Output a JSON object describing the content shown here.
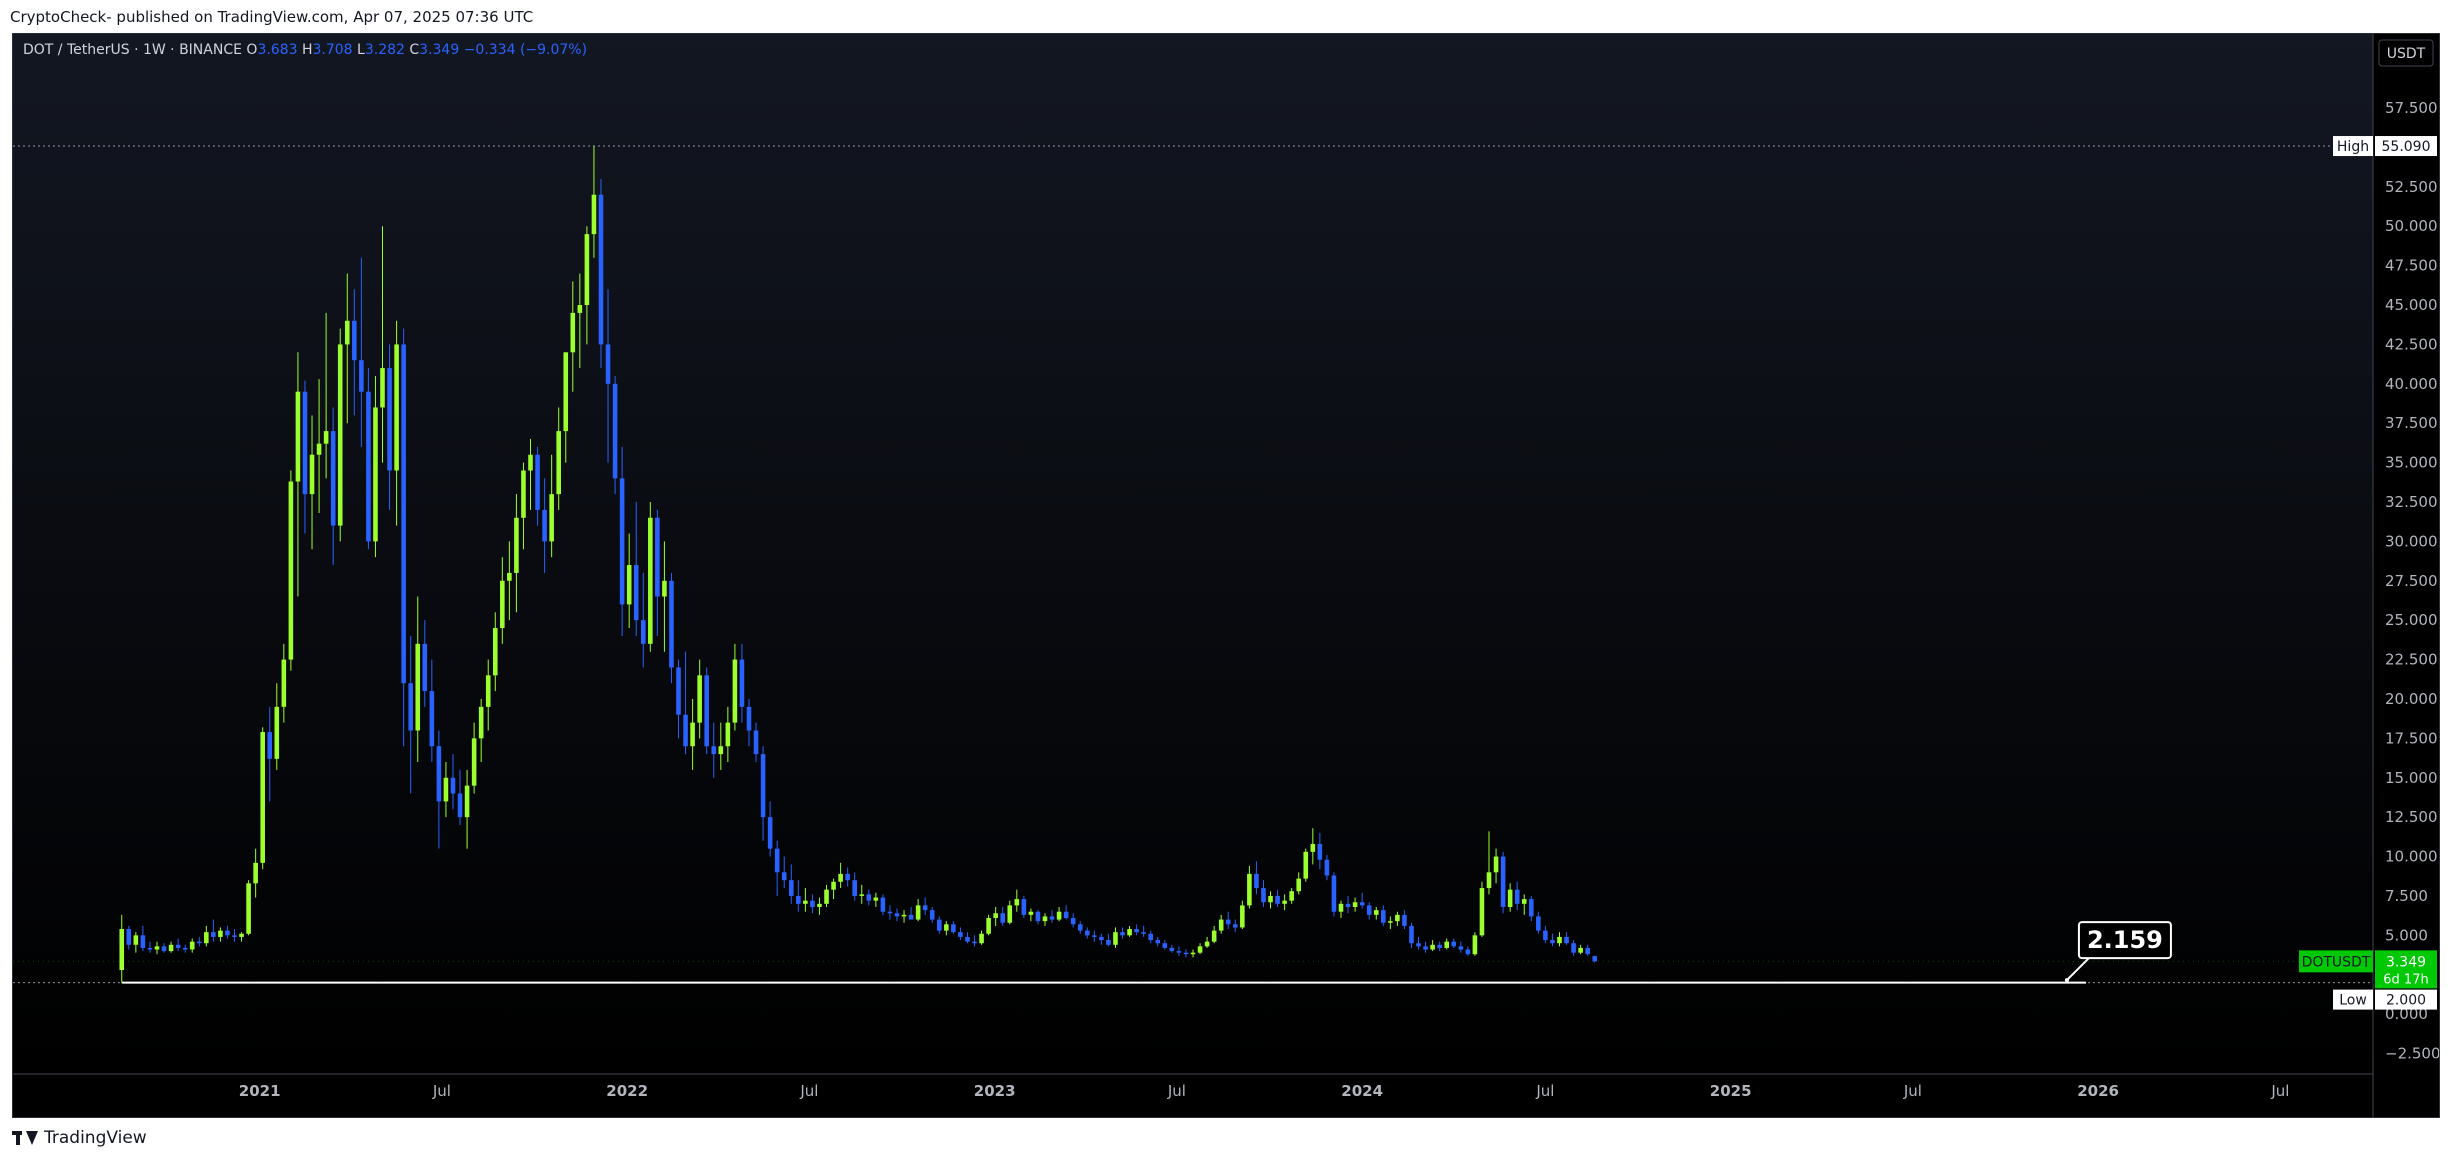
{
  "header": {
    "publisher": "CryptoCheck- published on TradingView.com, Apr 07, 2025 07:36 UTC"
  },
  "footer": {
    "brand": "TradingView"
  },
  "colors": {
    "up": "#9cff2e",
    "down": "#2962ff",
    "background": "#000000",
    "text": "#d1d4dc",
    "axis": "#b2b5be",
    "price_badge": "#00c805",
    "last_price_line": "#7a7a7a"
  },
  "chart_data": {
    "type": "candlestick",
    "symbol_line": {
      "symbol": "DOT / TetherUS · 1W · BINANCE",
      "o_label": "O",
      "o_value": "3.683",
      "h_label": "H",
      "h_value": "3.708",
      "l_label": "L",
      "l_value": "3.282",
      "c_label": "C",
      "c_value": "3.349",
      "change": "−0.334 (−9.07%)"
    },
    "currency": "USDT",
    "ylim": [
      -3.8,
      62.2
    ],
    "y_ticks": [
      57.5,
      52.5,
      50,
      47.5,
      45,
      42.5,
      40,
      37.5,
      35,
      32.5,
      30,
      27.5,
      25,
      22.5,
      20,
      17.5,
      15,
      12.5,
      10,
      7.5,
      5,
      0,
      -2.5
    ],
    "y_tick_labels": [
      "57.500",
      "52.500",
      "50.000",
      "47.500",
      "45.000",
      "42.500",
      "40.000",
      "37.500",
      "35.000",
      "32.500",
      "30.000",
      "27.500",
      "25.000",
      "22.500",
      "20.000",
      "17.500",
      "15.000",
      "12.500",
      "10.000",
      "7.500",
      "5.000",
      "0.000",
      "−2.500"
    ],
    "xlim": [
      "2020-05-01",
      "2026-10-01"
    ],
    "x_ticks": [
      {
        "date": "2021-01-01",
        "label": "2021",
        "bold": true
      },
      {
        "date": "2021-07-01",
        "label": "Jul",
        "bold": false
      },
      {
        "date": "2022-01-01",
        "label": "2022",
        "bold": true
      },
      {
        "date": "2022-07-01",
        "label": "Jul",
        "bold": false
      },
      {
        "date": "2023-01-01",
        "label": "2023",
        "bold": true
      },
      {
        "date": "2023-07-01",
        "label": "Jul",
        "bold": false
      },
      {
        "date": "2024-01-01",
        "label": "2024",
        "bold": true
      },
      {
        "date": "2024-07-01",
        "label": "Jul",
        "bold": false
      },
      {
        "date": "2025-01-01",
        "label": "2025",
        "bold": true
      },
      {
        "date": "2025-07-01",
        "label": "Jul",
        "bold": false
      },
      {
        "date": "2026-01-01",
        "label": "2026",
        "bold": true
      },
      {
        "date": "2026-07-01",
        "label": "Jul",
        "bold": false
      }
    ],
    "first_candle": "2020-08-17",
    "interval": "1W",
    "candles": [
      [
        2.8,
        6.3,
        2.0,
        5.4
      ],
      [
        5.4,
        5.6,
        4.1,
        4.4
      ],
      [
        4.4,
        5.2,
        3.9,
        5.0
      ],
      [
        5.0,
        5.6,
        4.0,
        4.2
      ],
      [
        4.2,
        4.6,
        3.9,
        4.1
      ],
      [
        4.1,
        4.6,
        3.8,
        4.3
      ],
      [
        4.3,
        4.5,
        3.9,
        4.0
      ],
      [
        4.0,
        4.6,
        3.9,
        4.4
      ],
      [
        4.4,
        4.8,
        4.0,
        4.2
      ],
      [
        4.2,
        4.4,
        3.9,
        4.1
      ],
      [
        4.1,
        4.8,
        3.9,
        4.6
      ],
      [
        4.6,
        4.9,
        4.3,
        4.5
      ],
      [
        4.5,
        5.6,
        4.3,
        5.2
      ],
      [
        5.2,
        6.0,
        4.6,
        4.9
      ],
      [
        4.9,
        5.5,
        4.6,
        5.3
      ],
      [
        5.3,
        5.6,
        4.8,
        5.0
      ],
      [
        5.0,
        5.4,
        4.6,
        4.9
      ],
      [
        4.9,
        5.2,
        4.6,
        5.1
      ],
      [
        5.1,
        8.5,
        5.0,
        8.3
      ],
      [
        8.3,
        10.5,
        7.4,
        9.6
      ],
      [
        9.6,
        18.2,
        9.2,
        17.9
      ],
      [
        17.9,
        19.5,
        13.5,
        16.2
      ],
      [
        16.2,
        21.0,
        15.5,
        19.5
      ],
      [
        19.5,
        23.5,
        18.5,
        22.5
      ],
      [
        22.5,
        34.5,
        21.8,
        33.8
      ],
      [
        33.8,
        42.0,
        26.5,
        39.5
      ],
      [
        39.5,
        40.2,
        30.5,
        33.0
      ],
      [
        33.0,
        38.0,
        29.5,
        35.5
      ],
      [
        35.5,
        40.3,
        31.8,
        36.2
      ],
      [
        36.2,
        44.5,
        34.0,
        37.0
      ],
      [
        37.0,
        38.5,
        28.5,
        31.0
      ],
      [
        31.0,
        43.5,
        30.0,
        42.5
      ],
      [
        42.5,
        47.0,
        37.5,
        44.0
      ],
      [
        44.0,
        46.0,
        38.0,
        41.5
      ],
      [
        41.5,
        48.0,
        36.0,
        39.5
      ],
      [
        39.5,
        41.0,
        29.5,
        30.0
      ],
      [
        30.0,
        40.5,
        29.0,
        38.5
      ],
      [
        38.5,
        50.0,
        35.0,
        41.0
      ],
      [
        41.0,
        42.5,
        32.0,
        34.5
      ],
      [
        34.5,
        44.0,
        31.0,
        42.5
      ],
      [
        42.5,
        43.5,
        17.0,
        21.0
      ],
      [
        21.0,
        24.0,
        14.0,
        18.0
      ],
      [
        18.0,
        26.5,
        16.0,
        23.5
      ],
      [
        23.5,
        25.0,
        19.5,
        20.5
      ],
      [
        20.5,
        22.5,
        16.0,
        17.0
      ],
      [
        17.0,
        18.0,
        10.5,
        13.5
      ],
      [
        13.5,
        16.0,
        12.5,
        15.0
      ],
      [
        15.0,
        16.5,
        13.0,
        14.0
      ],
      [
        14.0,
        15.5,
        12.0,
        12.5
      ],
      [
        12.5,
        15.5,
        10.5,
        14.5
      ],
      [
        14.5,
        18.5,
        14.0,
        17.5
      ],
      [
        17.5,
        20.0,
        16.0,
        19.5
      ],
      [
        19.5,
        22.5,
        18.0,
        21.5
      ],
      [
        21.5,
        25.5,
        20.5,
        24.5
      ],
      [
        24.5,
        29.0,
        23.5,
        27.5
      ],
      [
        27.5,
        30.0,
        25.0,
        28.0
      ],
      [
        28.0,
        33.0,
        25.5,
        31.5
      ],
      [
        31.5,
        35.0,
        29.5,
        34.5
      ],
      [
        34.5,
        36.5,
        32.0,
        35.5
      ],
      [
        35.5,
        36.0,
        31.0,
        32.0
      ],
      [
        32.0,
        34.0,
        28.0,
        30.0
      ],
      [
        30.0,
        35.5,
        29.0,
        33.0
      ],
      [
        33.0,
        38.5,
        32.0,
        37.0
      ],
      [
        37.0,
        42.0,
        35.0,
        42.0
      ],
      [
        42.0,
        46.5,
        39.5,
        44.5
      ],
      [
        44.5,
        47.0,
        41.0,
        45.0
      ],
      [
        45.0,
        50.0,
        42.5,
        49.5
      ],
      [
        49.5,
        55.1,
        48.0,
        52.0
      ],
      [
        52.0,
        53.0,
        41.0,
        42.5
      ],
      [
        42.5,
        46.0,
        35.0,
        40.0
      ],
      [
        40.0,
        40.5,
        33.0,
        34.0
      ],
      [
        34.0,
        36.0,
        24.0,
        26.0
      ],
      [
        26.0,
        30.5,
        24.5,
        28.5
      ],
      [
        28.5,
        32.5,
        24.0,
        25.0
      ],
      [
        25.0,
        28.0,
        22.0,
        23.5
      ],
      [
        23.5,
        32.5,
        23.0,
        31.5
      ],
      [
        31.5,
        32.0,
        24.0,
        26.5
      ],
      [
        26.5,
        30.0,
        23.0,
        27.5
      ],
      [
        27.5,
        28.0,
        21.0,
        22.0
      ],
      [
        22.0,
        22.5,
        17.5,
        19.0
      ],
      [
        19.0,
        23.0,
        16.5,
        17.0
      ],
      [
        17.0,
        20.0,
        15.5,
        18.5
      ],
      [
        18.5,
        22.5,
        17.5,
        21.5
      ],
      [
        21.5,
        22.0,
        16.5,
        17.0
      ],
      [
        17.0,
        18.5,
        15.0,
        16.5
      ],
      [
        16.5,
        18.5,
        15.5,
        17.0
      ],
      [
        17.0,
        19.5,
        16.0,
        18.5
      ],
      [
        18.5,
        23.5,
        18.0,
        22.5
      ],
      [
        22.5,
        23.5,
        18.5,
        19.5
      ],
      [
        19.5,
        20.0,
        17.0,
        18.0
      ],
      [
        18.0,
        18.5,
        16.0,
        16.5
      ],
      [
        16.5,
        17.0,
        11.0,
        12.5
      ],
      [
        12.5,
        13.5,
        10.0,
        10.5
      ],
      [
        10.5,
        11.0,
        7.5,
        9.0
      ],
      [
        9.0,
        10.0,
        8.0,
        8.5
      ],
      [
        8.5,
        9.5,
        7.0,
        7.5
      ],
      [
        7.5,
        8.5,
        6.5,
        7.0
      ],
      [
        7.0,
        8.0,
        6.5,
        7.2
      ],
      [
        7.2,
        7.6,
        6.4,
        6.8
      ],
      [
        6.8,
        7.4,
        6.3,
        7.0
      ],
      [
        7.0,
        8.2,
        6.8,
        7.9
      ],
      [
        7.9,
        8.6,
        7.3,
        8.4
      ],
      [
        8.4,
        9.6,
        8.0,
        8.9
      ],
      [
        8.9,
        9.3,
        8.1,
        8.5
      ],
      [
        8.5,
        9.0,
        7.2,
        7.5
      ],
      [
        7.5,
        8.2,
        7.0,
        7.6
      ],
      [
        7.6,
        7.9,
        6.9,
        7.2
      ],
      [
        7.2,
        7.7,
        6.8,
        7.4
      ],
      [
        7.4,
        7.6,
        6.3,
        6.5
      ],
      [
        6.5,
        6.9,
        6.0,
        6.4
      ],
      [
        6.4,
        6.7,
        5.9,
        6.2
      ],
      [
        6.2,
        6.6,
        5.8,
        6.3
      ],
      [
        6.3,
        6.8,
        6.0,
        6.0
      ],
      [
        6.0,
        7.3,
        5.9,
        6.9
      ],
      [
        6.9,
        7.4,
        6.3,
        6.6
      ],
      [
        6.6,
        6.8,
        5.8,
        6.0
      ],
      [
        6.0,
        6.2,
        5.1,
        5.3
      ],
      [
        5.3,
        5.9,
        5.0,
        5.7
      ],
      [
        5.7,
        5.9,
        5.1,
        5.2
      ],
      [
        5.2,
        5.5,
        4.7,
        4.9
      ],
      [
        4.9,
        5.2,
        4.5,
        4.6
      ],
      [
        4.6,
        5.0,
        4.3,
        4.5
      ],
      [
        4.5,
        5.3,
        4.4,
        5.1
      ],
      [
        5.1,
        6.3,
        5.0,
        6.1
      ],
      [
        6.1,
        6.8,
        5.6,
        6.4
      ],
      [
        6.4,
        6.8,
        5.6,
        5.8
      ],
      [
        5.8,
        7.2,
        5.7,
        6.9
      ],
      [
        6.9,
        7.9,
        6.5,
        7.3
      ],
      [
        7.3,
        7.5,
        6.1,
        6.3
      ],
      [
        6.3,
        6.7,
        5.9,
        6.5
      ],
      [
        6.5,
        6.6,
        5.7,
        5.9
      ],
      [
        5.9,
        6.4,
        5.6,
        6.2
      ],
      [
        6.2,
        6.6,
        5.8,
        6.0
      ],
      [
        6.0,
        6.8,
        5.9,
        6.5
      ],
      [
        6.5,
        6.9,
        6.0,
        6.1
      ],
      [
        6.1,
        6.4,
        5.5,
        5.7
      ],
      [
        5.7,
        5.9,
        5.1,
        5.3
      ],
      [
        5.3,
        5.5,
        4.8,
        5.0
      ],
      [
        5.0,
        5.3,
        4.6,
        4.9
      ],
      [
        4.9,
        5.1,
        4.4,
        4.7
      ],
      [
        4.7,
        5.1,
        4.3,
        4.4
      ],
      [
        4.4,
        5.5,
        4.2,
        5.2
      ],
      [
        5.2,
        5.5,
        4.8,
        5.0
      ],
      [
        5.0,
        5.6,
        4.9,
        5.4
      ],
      [
        5.4,
        5.7,
        5.0,
        5.2
      ],
      [
        5.2,
        5.6,
        4.9,
        5.1
      ],
      [
        5.1,
        5.3,
        4.5,
        4.7
      ],
      [
        4.7,
        4.9,
        4.3,
        4.5
      ],
      [
        4.5,
        4.7,
        4.1,
        4.2
      ],
      [
        4.2,
        4.4,
        3.9,
        4.0
      ],
      [
        4.0,
        4.3,
        3.7,
        3.9
      ],
      [
        3.9,
        4.1,
        3.6,
        3.8
      ],
      [
        3.8,
        4.1,
        3.6,
        3.9
      ],
      [
        3.9,
        4.5,
        3.8,
        4.3
      ],
      [
        4.3,
        4.9,
        4.2,
        4.6
      ],
      [
        4.6,
        5.6,
        4.5,
        5.3
      ],
      [
        5.3,
        6.3,
        5.1,
        6.0
      ],
      [
        6.0,
        6.5,
        5.4,
        5.7
      ],
      [
        5.7,
        6.0,
        5.2,
        5.5
      ],
      [
        5.5,
        7.2,
        5.4,
        6.9
      ],
      [
        6.9,
        9.4,
        6.7,
        8.9
      ],
      [
        8.9,
        9.7,
        7.6,
        8.0
      ],
      [
        8.0,
        8.5,
        6.8,
        7.1
      ],
      [
        7.1,
        7.8,
        6.7,
        7.5
      ],
      [
        7.5,
        7.9,
        6.8,
        7.0
      ],
      [
        7.0,
        7.6,
        6.6,
        7.2
      ],
      [
        7.2,
        8.0,
        7.0,
        7.8
      ],
      [
        7.8,
        9.0,
        7.6,
        8.6
      ],
      [
        8.6,
        10.5,
        8.4,
        10.3
      ],
      [
        10.3,
        11.8,
        9.5,
        10.8
      ],
      [
        10.8,
        11.5,
        9.2,
        9.8
      ],
      [
        9.8,
        10.1,
        8.5,
        8.8
      ],
      [
        8.8,
        9.0,
        6.2,
        6.5
      ],
      [
        6.5,
        7.2,
        6.1,
        7.0
      ],
      [
        7.0,
        7.5,
        6.4,
        6.8
      ],
      [
        6.8,
        7.4,
        6.5,
        7.1
      ],
      [
        7.1,
        7.7,
        6.7,
        6.9
      ],
      [
        6.9,
        7.1,
        6.0,
        6.3
      ],
      [
        6.3,
        6.8,
        6.0,
        6.6
      ],
      [
        6.6,
        6.9,
        5.6,
        5.8
      ],
      [
        5.8,
        6.2,
        5.4,
        5.9
      ],
      [
        5.9,
        6.5,
        5.6,
        6.3
      ],
      [
        6.3,
        6.6,
        5.4,
        5.6
      ],
      [
        5.6,
        5.8,
        4.2,
        4.5
      ],
      [
        4.5,
        4.9,
        4.1,
        4.3
      ],
      [
        4.3,
        4.6,
        3.9,
        4.1
      ],
      [
        4.1,
        4.7,
        4.0,
        4.4
      ],
      [
        4.4,
        4.6,
        4.0,
        4.2
      ],
      [
        4.2,
        4.8,
        4.1,
        4.6
      ],
      [
        4.6,
        4.8,
        4.2,
        4.3
      ],
      [
        4.3,
        4.6,
        3.9,
        4.1
      ],
      [
        4.1,
        4.3,
        3.7,
        3.8
      ],
      [
        3.8,
        5.2,
        3.7,
        5.0
      ],
      [
        5.0,
        8.4,
        4.9,
        8.0
      ],
      [
        8.0,
        11.6,
        7.6,
        9.0
      ],
      [
        9.0,
        10.5,
        8.3,
        10.0
      ],
      [
        10.0,
        10.3,
        6.4,
        6.8
      ],
      [
        6.8,
        8.3,
        6.5,
        7.9
      ],
      [
        7.9,
        8.4,
        6.6,
        7.0
      ],
      [
        7.0,
        7.6,
        6.3,
        7.3
      ],
      [
        7.3,
        7.5,
        5.9,
        6.2
      ],
      [
        6.2,
        6.5,
        5.1,
        5.3
      ],
      [
        5.3,
        5.6,
        4.5,
        4.7
      ],
      [
        4.7,
        5.1,
        4.3,
        4.5
      ],
      [
        4.5,
        5.2,
        4.3,
        4.9
      ],
      [
        4.9,
        5.2,
        4.4,
        4.5
      ],
      [
        4.5,
        4.7,
        3.7,
        3.9
      ],
      [
        3.9,
        4.4,
        3.8,
        4.2
      ],
      [
        4.2,
        4.4,
        3.7,
        3.8
      ],
      [
        3.68,
        3.71,
        3.28,
        3.35
      ]
    ],
    "high_marker": {
      "label": "High",
      "value": 55.09,
      "text": "55.090"
    },
    "low_marker": {
      "label": "Low",
      "value": 2.0,
      "text": "2.000"
    },
    "last_price": {
      "symbol": "DOTUSDT",
      "value": 3.349,
      "text": "3.349",
      "countdown": "6d 17h"
    },
    "support_line": {
      "value": 2.0,
      "start_date": "2020-08-17",
      "end_date": "2025-12-20"
    },
    "annotation": {
      "text": "2.159",
      "date": "2025-12-01",
      "value": 2.159
    }
  }
}
